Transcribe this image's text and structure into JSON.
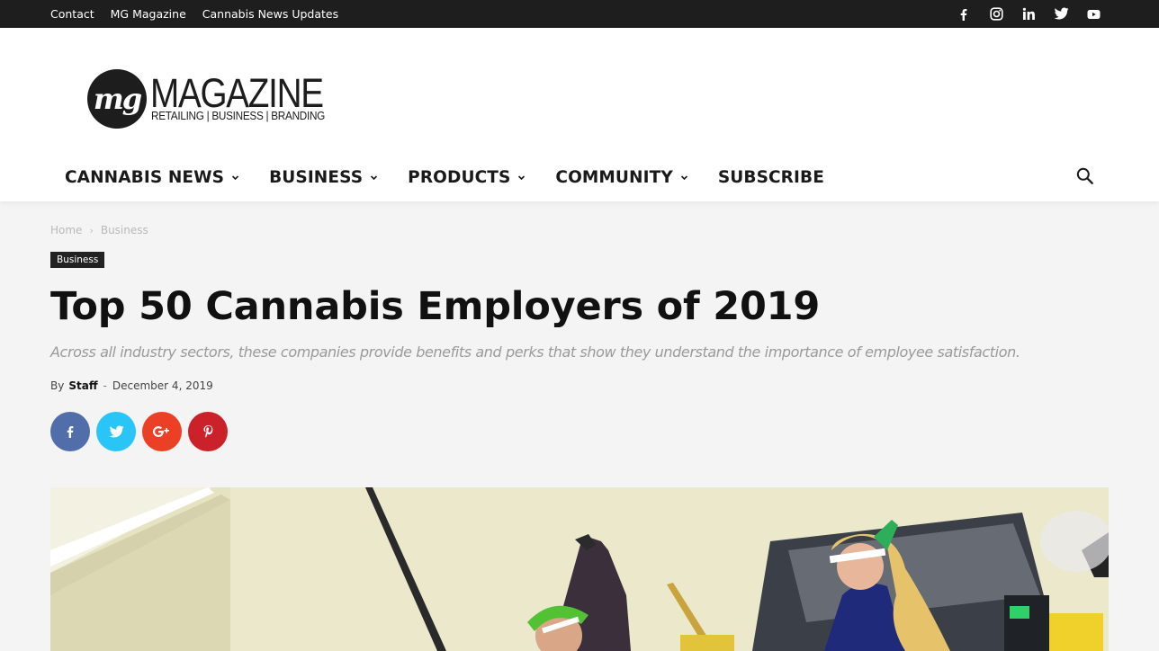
{
  "topbar": {
    "links": [
      "Contact",
      "MG Magazine",
      "Cannabis News Updates"
    ],
    "social_icons": [
      "facebook-icon",
      "instagram-icon",
      "linkedin-icon",
      "twitter-icon",
      "youtube-icon"
    ]
  },
  "logo": {
    "mark": "mg",
    "wordmark": "MAGAZINE",
    "tagline": "RETAILING | BUSINESS | BRANDING"
  },
  "nav": {
    "items": [
      {
        "label": "CANNABIS NEWS",
        "has_dropdown": true
      },
      {
        "label": "BUSINESS",
        "has_dropdown": true
      },
      {
        "label": "PRODUCTS",
        "has_dropdown": true
      },
      {
        "label": "COMMUNITY",
        "has_dropdown": true
      },
      {
        "label": "SUBSCRIBE",
        "has_dropdown": false
      }
    ],
    "search_icon": "search-icon"
  },
  "breadcrumb": {
    "items": [
      "Home",
      "Business"
    ]
  },
  "article": {
    "category": "Business",
    "title": "Top 50 Cannabis Employers of 2019",
    "subtitle": "Across all industry sectors, these companies provide benefits and perks that show they understand the importance of employee satisfaction.",
    "by_label": "By",
    "author": "Staff",
    "separator": "-",
    "date": "December 4, 2019"
  },
  "share": {
    "buttons": [
      {
        "icon": "facebook-icon",
        "color": "#516eab"
      },
      {
        "icon": "twitter-icon",
        "color": "#29c5f6"
      },
      {
        "icon": "google-plus-icon",
        "color": "#eb4026"
      },
      {
        "icon": "pinterest-icon",
        "color": "#ca212a"
      }
    ]
  },
  "colors": {
    "topbar_bg": "#1e1e1e",
    "category_bg": "#222222"
  }
}
